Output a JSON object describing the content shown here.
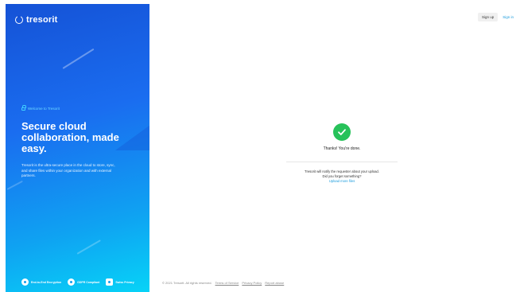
{
  "brand": {
    "logo_text": "tresorit",
    "accent_color": "#1a6df0"
  },
  "left_panel": {
    "welcome": "Welcome to Tresorit",
    "headline": "Secure cloud collaboration, made easy.",
    "description": "Tresorit is the ultra-secure place in the cloud to store, sync, and share files within your organization and with external partners.",
    "badges": [
      {
        "label": "End-to-End Encryption",
        "icon": "lock-badge-icon"
      },
      {
        "label": "GDPR Compliant",
        "icon": "check-badge-icon"
      },
      {
        "label": "Swiss Privacy",
        "icon": "swiss-flag-icon"
      }
    ]
  },
  "header": {
    "signup_label": "Sign up",
    "signin_label": "Sign in"
  },
  "main": {
    "success_icon": "checkmark-icon",
    "success_color": "#27c25a",
    "done_text": "Thanks! You're done.",
    "notify_text": "Tresorit will notify the requester about your upload.",
    "forgot_text": "Did you forget something?",
    "upload_more_label": "Upload more files"
  },
  "footer": {
    "copyright": "© 2021 Tresorit. All rights reserved.",
    "terms_label": "Terms of Service",
    "privacy_label": "Privacy Policy",
    "abuse_label": "Report abuse"
  }
}
